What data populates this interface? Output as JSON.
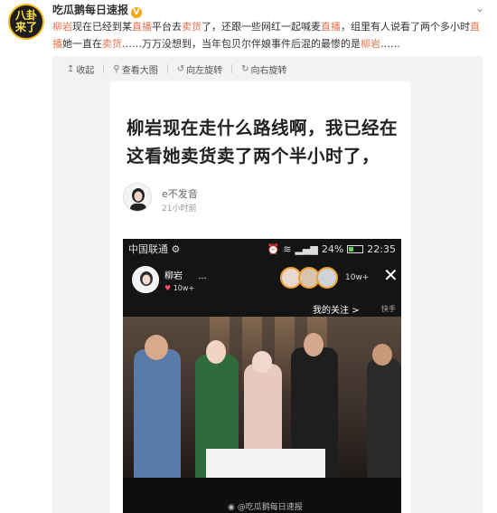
{
  "post": {
    "avatar_text": "八卦\n来了",
    "username": "吃瓜鹅每日速报",
    "text_segments": [
      {
        "t": "柳岩",
        "h": true
      },
      {
        "t": "现在已经到某",
        "h": false
      },
      {
        "t": "直播",
        "h": true
      },
      {
        "t": "平台去",
        "h": false
      },
      {
        "t": "卖货",
        "h": true
      },
      {
        "t": "了，还跟一些网红一起喊麦",
        "h": false
      },
      {
        "t": "直播",
        "h": true
      },
      {
        "t": "，组里有人说看了两个多小时",
        "h": false
      },
      {
        "t": "直播",
        "h": true
      },
      {
        "t": "她一直在",
        "h": false
      },
      {
        "t": "卖货",
        "h": true
      },
      {
        "t": "……万万没想到，当年包贝尔伴娘事件后混的最惨的是",
        "h": false
      },
      {
        "t": "柳岩",
        "h": true
      },
      {
        "t": "……",
        "h": false
      }
    ]
  },
  "toolbar": {
    "collapse": "收起",
    "view_large": "查看大图",
    "rotate_left": "向左旋转",
    "rotate_right": "向右旋转"
  },
  "screenshot": {
    "title": "柳岩现在走什么路线啊，我已经在这看她卖货卖了两个半小时了，",
    "commenter": "e不发音",
    "time": "21小时前"
  },
  "phone": {
    "carrier": "中国联通",
    "battery": "24%",
    "battery_level": 0.24,
    "time": "22:35",
    "host_name": "柳岩",
    "host_more": "...",
    "host_likes": "10w+",
    "viewer_count": "10w+",
    "my_follow": "我的关注 >",
    "quick": "快手",
    "watermark": "@吃瓜鹅每日速报"
  },
  "colors": {
    "highlight": "#eb7350",
    "verified": "#f6a90e"
  }
}
